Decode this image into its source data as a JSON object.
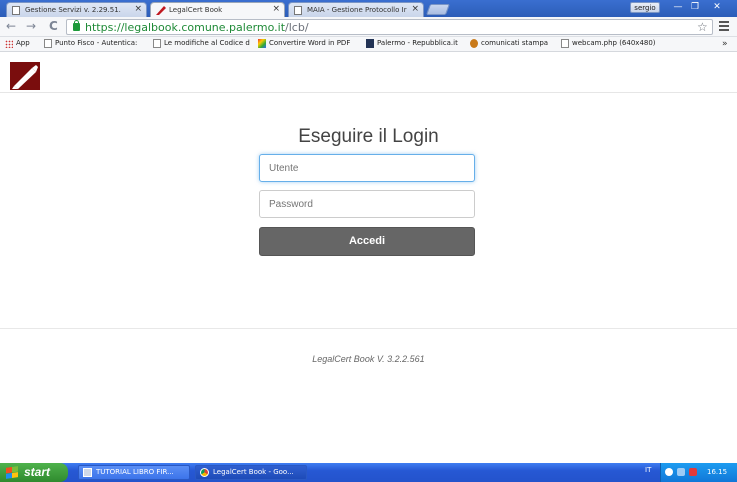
{
  "browser": {
    "tabs": [
      {
        "label": "Gestione Servizi v. 2.29.51.",
        "active": false
      },
      {
        "label": "LegalCert Book",
        "active": true
      },
      {
        "label": "MAIA - Gestione Protocollo Ir",
        "active": false
      }
    ],
    "user": "sergio",
    "window_buttons": {
      "minimize": "—",
      "restore": "❐",
      "close": "✕"
    },
    "nav": {
      "back": "←",
      "forward": "→",
      "reload": "C"
    },
    "url_host": "https://legalbook.comune.palermo.it",
    "url_path": "/lcb/",
    "bookmarks": [
      {
        "label": "App",
        "icon": "apps-icon"
      },
      {
        "label": "Punto Fisco - Autentica:",
        "icon": "page-icon"
      },
      {
        "label": "Le modifiche al Codice d",
        "icon": "page-icon"
      },
      {
        "label": "Convertire Word in PDF",
        "icon": "pdf-icon"
      },
      {
        "label": "Palermo - Repubblica.it",
        "icon": "rep-icon"
      },
      {
        "label": "comunicati stampa",
        "icon": "globe-icon"
      },
      {
        "label": "webcam.php (640x480)",
        "icon": "page-icon"
      }
    ],
    "bookmarks_more": "»",
    "star": "☆"
  },
  "page": {
    "login_title": "Eseguire il Login",
    "username_placeholder": "Utente",
    "password_placeholder": "Password",
    "submit_label": "Accedi",
    "footer_version": "LegalCert Book  V. 3.2.2.561"
  },
  "taskbar": {
    "start_label": "start",
    "tasks": [
      {
        "label": "TUTORIAL LIBRO FIR...",
        "active": false
      },
      {
        "label": "LegalCert Book - Goo...",
        "active": true
      }
    ],
    "language": "IT",
    "clock": "16.15"
  },
  "colors": {
    "accent_focus": "#66afe9",
    "submit_bg": "#666666",
    "logo_bg": "#7a0d0d",
    "url_secure": "#1f8a37"
  }
}
